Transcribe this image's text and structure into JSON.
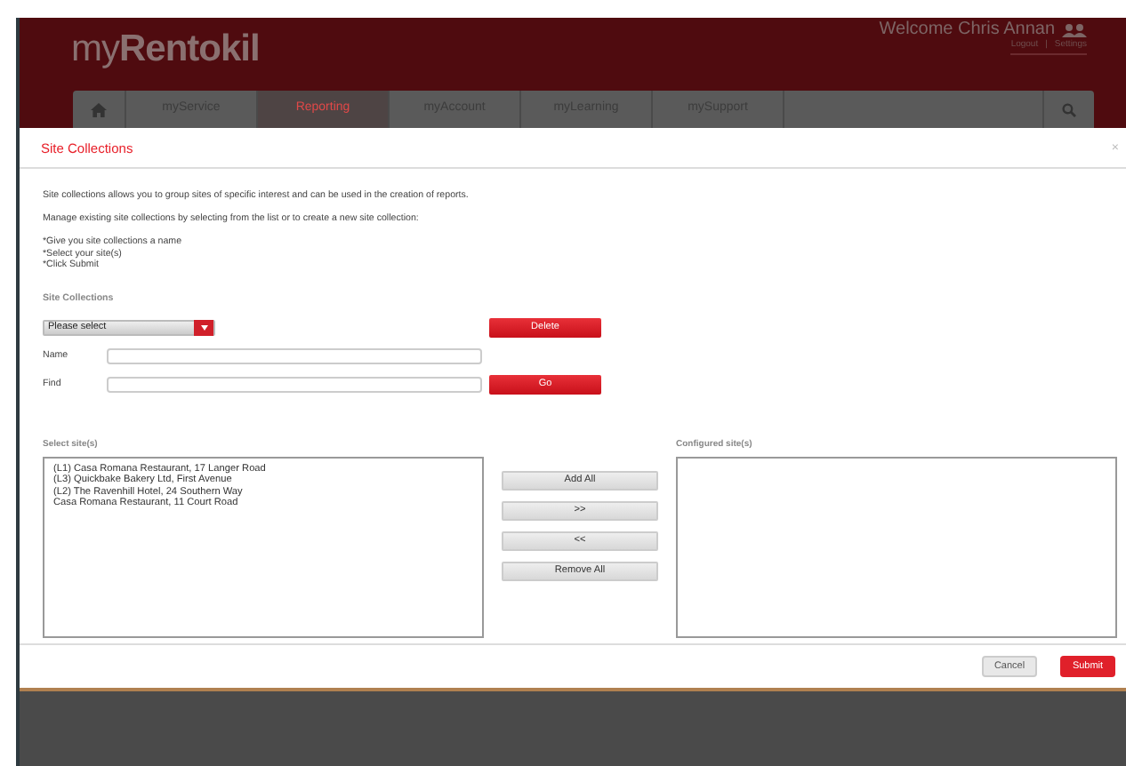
{
  "header": {
    "logo_light": "my",
    "logo_bold": "Rentokil",
    "welcome": "Welcome  Chris Annan",
    "links": [
      "Logout",
      "Settings"
    ],
    "separator": "|"
  },
  "nav": [
    {
      "label": "myService",
      "selected": false
    },
    {
      "label": "Reporting",
      "selected": true
    },
    {
      "label": "myAccount",
      "selected": false
    },
    {
      "label": "myLearning",
      "selected": false
    },
    {
      "label": "mySupport",
      "selected": false
    }
  ],
  "dialog": {
    "title": "Site Collections",
    "close": "×",
    "intro": [
      "Site collections allows you to group sites of specific interest and can be used in the creation of reports.",
      "Manage existing site collections by selecting from the list or to create a new site collection:"
    ],
    "steps": [
      "*Give you site collections a name",
      "*Select your site(s)",
      "*Click Submit"
    ],
    "section": "Site Collections",
    "dropdown": "Please select",
    "delete": "Delete",
    "name_label": "Name",
    "find_label": "Find",
    "go": "Go",
    "select_label": "Select site(s)",
    "configured_label": "Configured site(s)",
    "sites": [
      "(L1) Casa Romana Restaurant, 17 Langer Road",
      "(L3) Quickbake Bakery Ltd, First Avenue",
      "(L2) The Ravenhill Hotel, 24 Southern Way",
      "Casa Romana Restaurant, 11 Court Road"
    ],
    "transfer": [
      "Add All",
      ">>",
      "<<",
      "Remove All"
    ],
    "cancel": "Cancel",
    "submit": "Submit"
  }
}
